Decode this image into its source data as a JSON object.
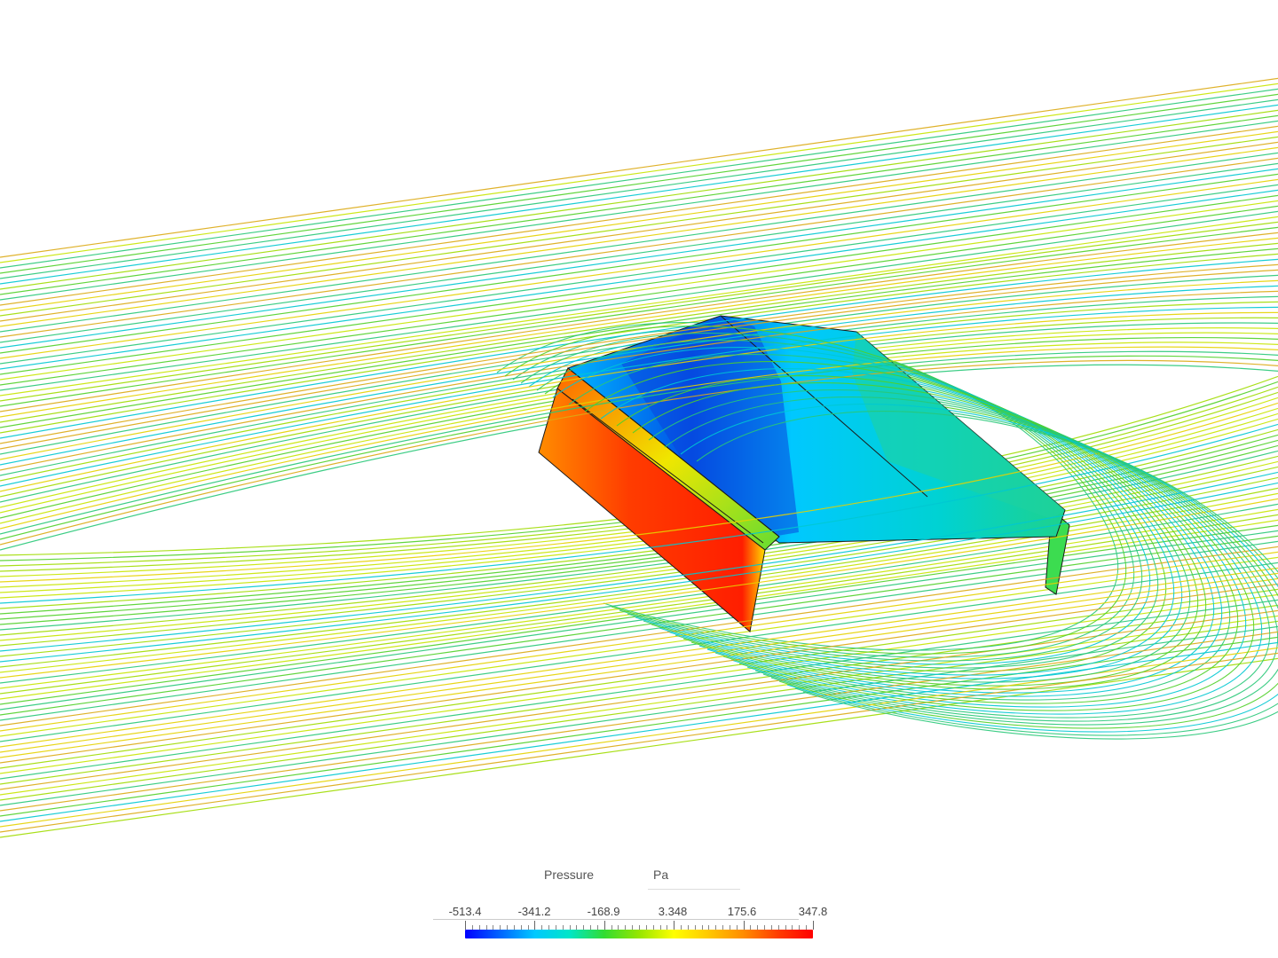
{
  "legend": {
    "quantity": "Pressure",
    "unit": "Pa",
    "ticks": [
      "-513.4",
      "-341.2",
      "-168.9",
      "3.348",
      "175.6",
      "347.8"
    ],
    "colormap": [
      "#0000ff",
      "#0064ff",
      "#00c8ff",
      "#00e6c8",
      "#32dc32",
      "#96e600",
      "#ffff00",
      "#ffc800",
      "#ff8c00",
      "#ff3c00",
      "#ff0000"
    ]
  },
  "scene": {
    "object": "box-roof",
    "streamline_colors": [
      "#c8e600",
      "#a0dc00",
      "#50d028",
      "#28c878",
      "#00c8d2",
      "#e6d200",
      "#dcaa14"
    ],
    "surface_colors": {
      "high_pressure": "#ff2800",
      "front_gradient": "#ff9600",
      "ridge": "#e6e600",
      "roof_low": "#0032dc",
      "roof_mid": "#00aaff",
      "roof_field": "#00c8dc",
      "rear": "#32dc64"
    }
  }
}
